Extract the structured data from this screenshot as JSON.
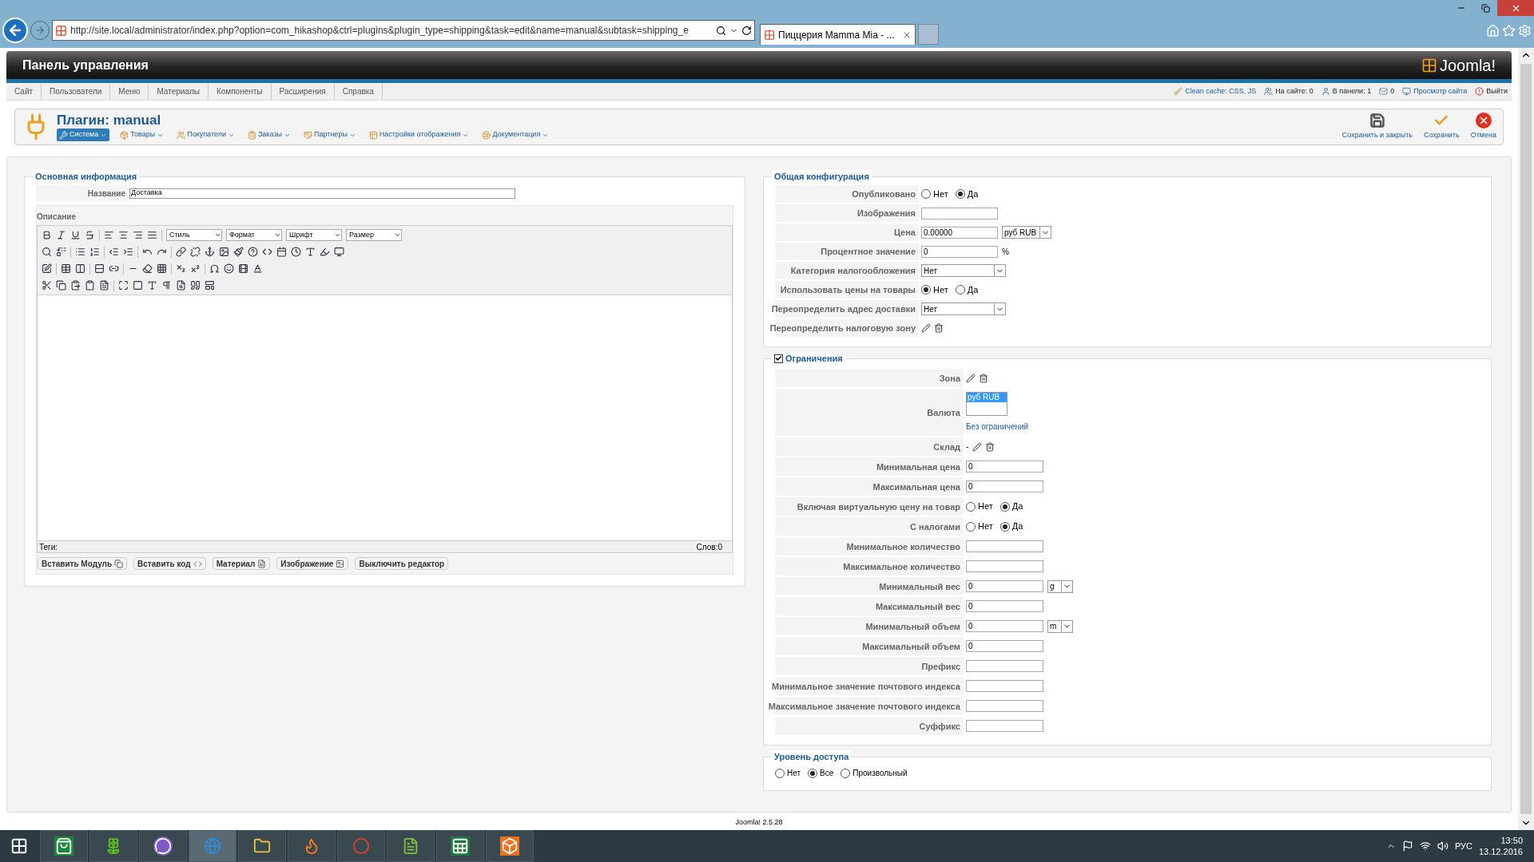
{
  "browser": {
    "address": "http://site.local/administrator/index.php?option=com_hikashop&ctrl=plugins&plugin_type=shipping&task=edit&name=manual&subtask=shipping_e",
    "tab_title": "Пиццерия Mamma Mia - ..."
  },
  "header": {
    "title": "Панель управления",
    "logo_text": "Joomla!"
  },
  "menu": [
    {
      "label": "Сайт"
    },
    {
      "label": "Пользователи"
    },
    {
      "label": "Меню"
    },
    {
      "label": "Материалы"
    },
    {
      "label": "Компоненты"
    },
    {
      "label": "Расширения"
    },
    {
      "label": "Справка"
    }
  ],
  "status": [
    {
      "kind": "cache",
      "label": "Clean cache: CSS, JS"
    },
    {
      "kind": "online",
      "label": "На сайте: 0"
    },
    {
      "kind": "admin",
      "label": "В панели: 1"
    },
    {
      "kind": "messages",
      "label": "0"
    },
    {
      "kind": "preview",
      "label": "Просмотр сайта"
    },
    {
      "kind": "logout",
      "label": "Выйти"
    }
  ],
  "page": {
    "title": "Плагин: manual",
    "submenu": [
      {
        "kind": "system",
        "label": "Система",
        "selected": true
      },
      {
        "kind": "products",
        "label": "Товары",
        "selected": false
      },
      {
        "kind": "customers",
        "label": "Покупатели",
        "selected": false
      },
      {
        "kind": "orders",
        "label": "Заказы",
        "selected": false
      },
      {
        "kind": "partners",
        "label": "Партнеры",
        "selected": false
      },
      {
        "kind": "display",
        "label": "Настройки отображения",
        "selected": false
      },
      {
        "kind": "docs",
        "label": "Документация",
        "selected": false
      }
    ],
    "actions": [
      {
        "kind": "save",
        "label": "Сохранить и закрыть"
      },
      {
        "kind": "apply",
        "label": "Сохранить"
      },
      {
        "kind": "cancel",
        "label": "Отмена"
      }
    ]
  },
  "main_info": {
    "legend": "Основная информация",
    "name_label": "Название",
    "name_value": "Доставка",
    "description_label": "Описание",
    "editor": {
      "dropdowns": [
        "Стиль",
        "Формат",
        "Шрифт",
        "Размер"
      ],
      "tags_label": "Теги:",
      "word_count": "Слов:0"
    },
    "buttons": [
      {
        "kind": "module",
        "label": "Вставить Модуль"
      },
      {
        "kind": "code",
        "label": "Вставить код"
      },
      {
        "kind": "article",
        "label": "Материал"
      },
      {
        "kind": "image",
        "label": "Изображение"
      },
      {
        "kind": "plain",
        "label": "Выключить редактор"
      }
    ]
  },
  "general": {
    "legend": "Общая конфигурация",
    "rows": [
      {
        "kind": "radio",
        "label": "Опубликовано",
        "options": [
          {
            "label": "Нет",
            "selected": false
          },
          {
            "label": "Да",
            "selected": true
          }
        ]
      },
      {
        "kind": "input",
        "label": "Изображения"
      },
      {
        "kind": "input_select",
        "label": "Цена",
        "value": "0.00000",
        "select": "руб RUB"
      },
      {
        "kind": "input",
        "label": "Процентное значение",
        "value": "0",
        "suffix": "%"
      },
      {
        "kind": "select",
        "label": "Категория налогообложения",
        "value": "Нет"
      },
      {
        "kind": "radio",
        "label": "Использовать цены на товары",
        "options": [
          {
            "label": "Нет",
            "selected": true
          },
          {
            "label": "Да",
            "selected": false
          }
        ]
      },
      {
        "kind": "select",
        "label": "Переопределить адрес доставки",
        "value": "Нет"
      },
      {
        "kind": "icons",
        "label": "Переопределить налоговую зону"
      }
    ]
  },
  "restrictions": {
    "legend": "Ограничения",
    "checked": true,
    "rows": [
      {
        "kind": "icons",
        "label": "Зона"
      },
      {
        "kind": "listbox",
        "label": "Валюта",
        "options": [
          {
            "label": "руб RUB",
            "selected": true
          }
        ],
        "link": "Без ограничений"
      },
      {
        "kind": "icons",
        "label": "Склад",
        "prefix": "-"
      },
      {
        "kind": "input",
        "label": "Минимальная цена",
        "value": "0"
      },
      {
        "kind": "input",
        "label": "Максимальная цена",
        "value": "0"
      },
      {
        "kind": "radio",
        "label": "Включая виртуальную цену на товар",
        "options": [
          {
            "label": "Нет",
            "selected": false
          },
          {
            "label": "Да",
            "selected": true
          }
        ]
      },
      {
        "kind": "radio",
        "label": "С налогами",
        "options": [
          {
            "label": "Нет",
            "selected": false
          },
          {
            "label": "Да",
            "selected": true
          }
        ]
      },
      {
        "kind": "input",
        "label": "Минимальное количество"
      },
      {
        "kind": "input",
        "label": "Максимальное количество"
      },
      {
        "kind": "input_select",
        "label": "Минимальный вес",
        "value": "0",
        "select": "g"
      },
      {
        "kind": "input",
        "label": "Максимальный вес",
        "value": "0"
      },
      {
        "kind": "input_select",
        "label": "Минимальный объем",
        "value": "0",
        "select": "m"
      },
      {
        "kind": "input",
        "label": "Максимальный объем",
        "value": "0"
      },
      {
        "kind": "input",
        "label": "Префикс"
      },
      {
        "kind": "input",
        "label": "Минимальное значение почтового индекса"
      },
      {
        "kind": "input",
        "label": "Максимальное значение почтового индекса"
      },
      {
        "kind": "input",
        "label": "Суффикс"
      }
    ]
  },
  "access": {
    "legend": "Уровень доступа",
    "options": [
      {
        "label": "Нет",
        "selected": false
      },
      {
        "label": "Все",
        "selected": true
      },
      {
        "label": "Произвольный",
        "selected": false
      }
    ]
  },
  "footer": "Joomla! 2.5.28",
  "taskbar": {
    "language": "РУС",
    "time": "13:50",
    "date": "13.12.2016"
  }
}
